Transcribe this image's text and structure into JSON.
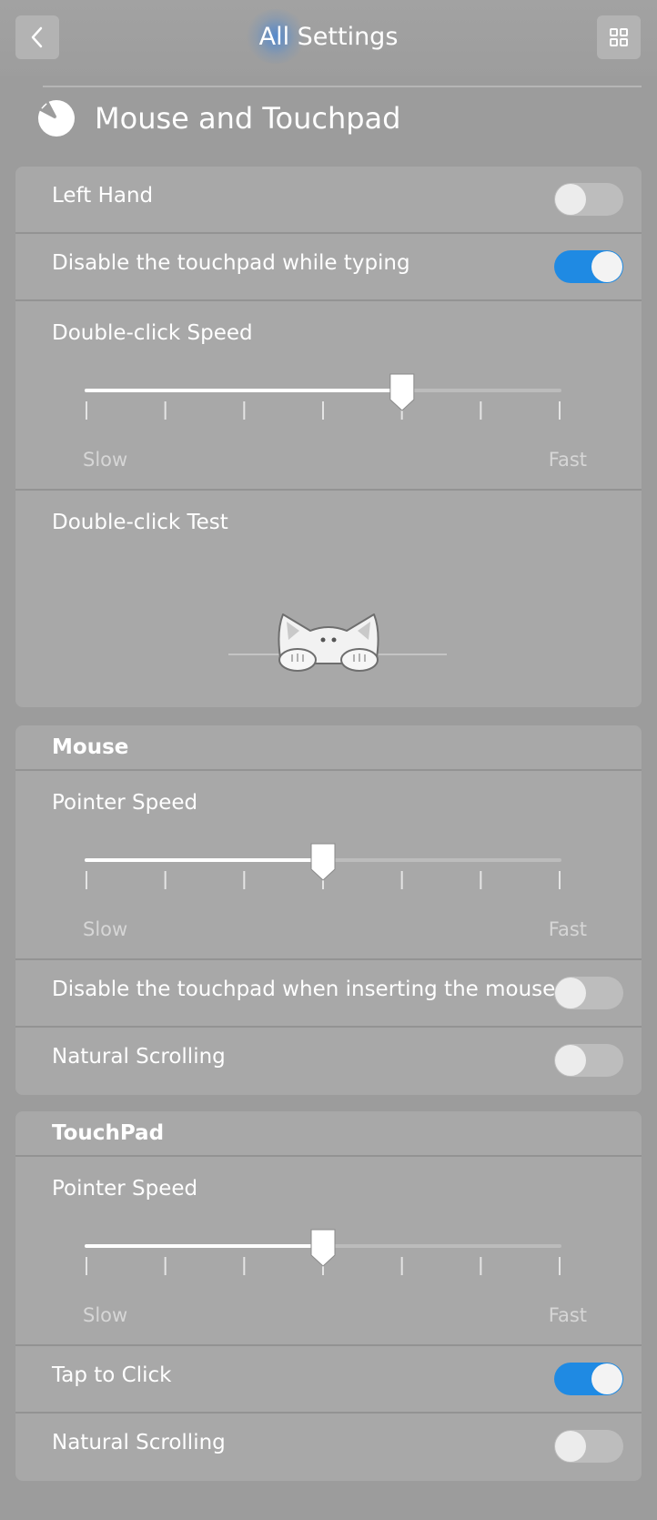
{
  "header": {
    "title": "All Settings",
    "back_icon": "chevron-left-icon",
    "grid_icon": "grid-icon"
  },
  "page": {
    "title": "Mouse and Touchpad",
    "icon": "mouse-icon"
  },
  "general": {
    "left_hand": {
      "label": "Left Hand",
      "on": false
    },
    "disable_typing": {
      "label": "Disable the touchpad while typing",
      "on": true
    },
    "double_click_speed": {
      "label": "Double-click Speed",
      "min_label": "Slow",
      "max_label": "Fast",
      "ticks": 7,
      "value_fraction": 0.667
    },
    "double_click_test": {
      "label": "Double-click Test",
      "image": "cat-illustration"
    }
  },
  "mouse": {
    "section_title": "Mouse",
    "pointer_speed": {
      "label": "Pointer Speed",
      "min_label": "Slow",
      "max_label": "Fast",
      "ticks": 7,
      "value_fraction": 0.5
    },
    "disable_when_mouse": {
      "label": "Disable the touchpad when inserting the mouse",
      "on": false
    },
    "natural_scrolling": {
      "label": "Natural Scrolling",
      "on": false
    }
  },
  "touchpad": {
    "section_title": "TouchPad",
    "pointer_speed": {
      "label": "Pointer Speed",
      "min_label": "Slow",
      "max_label": "Fast",
      "ticks": 7,
      "value_fraction": 0.5
    },
    "tap_to_click": {
      "label": "Tap to Click",
      "on": true
    },
    "natural_scrolling": {
      "label": "Natural Scrolling",
      "on": false
    }
  },
  "colors": {
    "accent": "#1f8ae3",
    "background": "#9c9c9c",
    "card": "#a8a8a8"
  }
}
